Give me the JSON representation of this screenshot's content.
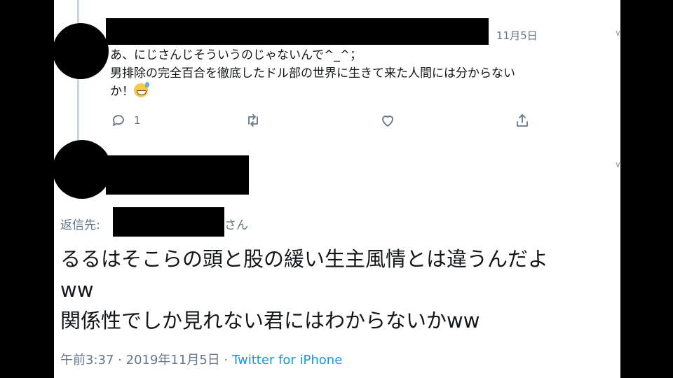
{
  "parent_tweet": {
    "timestamp": "11月5日",
    "text_line1": "あ、にじさんじそういうのじゃないんで^_^；",
    "text_line2": "男排除の完全百合を徹底したドル部の世界に生きて来た人間には分からない",
    "text_line3": "か！",
    "emoji": "grinning-sweat",
    "reply_count": "1"
  },
  "reply_tweet": {
    "replying_label": "返信先:",
    "replying_suffix": "さん",
    "text": "るるはそこらの頭と股の緩い生主風情とは違うんだよ\nww\n関係性でしか見れない君にはわからないかww",
    "time": "午前3:37",
    "separator": "·",
    "date": "2019年11月5日",
    "source": "Twitter for iPhone"
  },
  "colors": {
    "link": "#1b95e0",
    "muted": "#657786",
    "text": "#14171a",
    "thread_line": "#ccd6dd"
  }
}
